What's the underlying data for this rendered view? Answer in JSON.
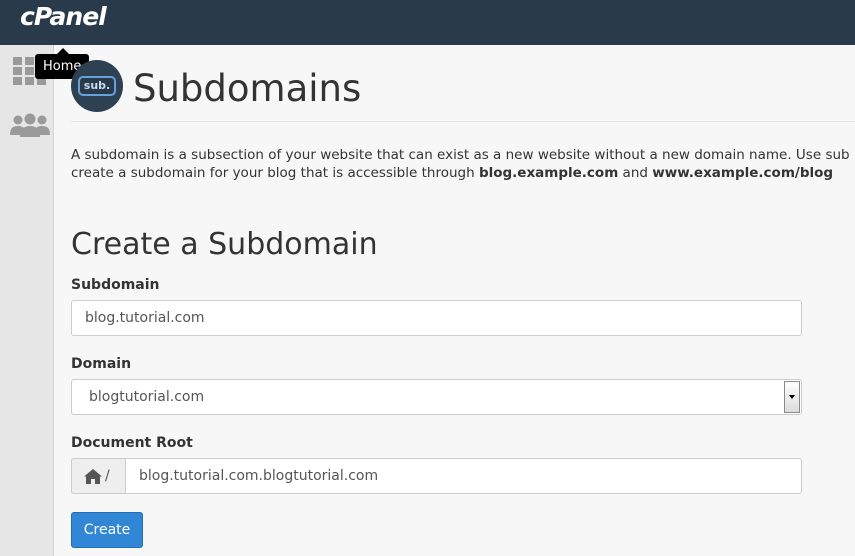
{
  "header": {
    "logo_text": "cPanel",
    "background_color": "#293a4a"
  },
  "sidebar": {
    "items": [
      {
        "name": "home",
        "icon": "grid-icon",
        "tooltip": "Home"
      },
      {
        "name": "users",
        "icon": "users-icon"
      }
    ]
  },
  "page": {
    "icon_text": "sub.",
    "title": "Subdomains",
    "description_line1": "A subdomain is a subsection of your website that can exist as a new website without a new domain name. Use sub",
    "description_line2_prefix": "create a subdomain for your blog that is accessible through ",
    "description_example1": "blog.example.com",
    "description_and": " and ",
    "description_example2": "www.example.com/blog"
  },
  "form": {
    "section_title": "Create a Subdomain",
    "subdomain_label": "Subdomain",
    "subdomain_value": "blog.tutorial.com",
    "domain_label": "Domain",
    "domain_value": "blogtutorial.com",
    "document_root_label": "Document Root",
    "document_root_prefix": "/",
    "document_root_value": "blog.tutorial.com.blogtutorial.com",
    "create_label": "Create"
  },
  "colors": {
    "accent": "#3187d5",
    "page_background": "#f7f7f7",
    "sidebar_background": "#e6e6e6"
  }
}
